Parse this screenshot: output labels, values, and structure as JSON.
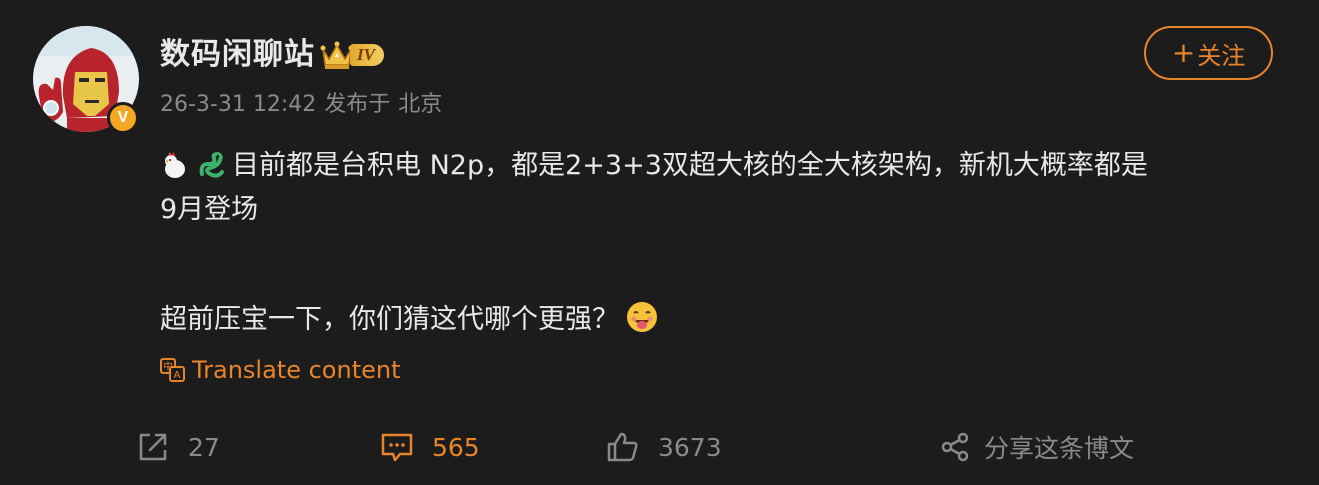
{
  "author": {
    "name": "数码闲聊站",
    "level": "IV",
    "verified_badge": "V"
  },
  "post": {
    "date": "26-3-31 12:42",
    "source_prefix": "发布于",
    "location": "北京",
    "line1": "目前都是台积电 N2p，都是2+3+3双超大核的全大核架构，新机大概率都是",
    "line2": "9月登场",
    "line3": "超前压宝一下，你们猜这代哪个更强？",
    "emojis": [
      "chicken-icon",
      "dragon-icon",
      "tongue-face-icon"
    ]
  },
  "follow": {
    "plus": "+",
    "label": "关注"
  },
  "translate": {
    "label": "Translate content"
  },
  "actions": {
    "repost_count": "27",
    "comment_count": "565",
    "like_count": "3673",
    "share_label": "分享这条博文"
  },
  "colors": {
    "background": "#1c1c1c",
    "accent": "#e8842a",
    "muted": "#8a8a8a",
    "text": "#e8e8e8"
  }
}
